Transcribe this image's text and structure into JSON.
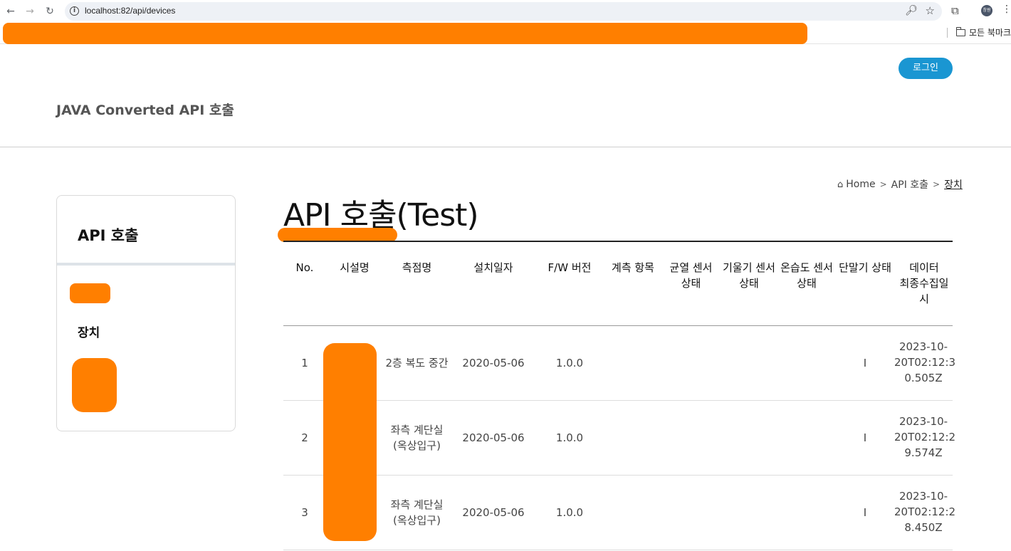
{
  "browser": {
    "url": "localhost:82/api/devices",
    "bookmarks_all": "모든 북마크",
    "profile_initials": "창원"
  },
  "header": {
    "login_label": "로그인",
    "site_title": "JAVA Converted API 호출"
  },
  "sidebar": {
    "title": "API 호출",
    "items": [
      {
        "label": "장치"
      }
    ]
  },
  "breadcrumb": {
    "home": "Home",
    "level1": "API 호출",
    "current": "장치"
  },
  "page_title": "API 호출(Test)",
  "table": {
    "headers": [
      [
        "No."
      ],
      [
        "시설명"
      ],
      [
        "측점명"
      ],
      [
        "설치일자"
      ],
      [
        "F/W 버전"
      ],
      [
        "계측 항목"
      ],
      [
        "균열 센서",
        "상태"
      ],
      [
        "기울기 센서",
        "상태"
      ],
      [
        "온습도 센서",
        "상태"
      ],
      [
        "단말기 상태"
      ],
      [
        "데이터",
        "최종수집일",
        "시"
      ]
    ],
    "rows": [
      {
        "no": "1",
        "facility": "",
        "point": [
          "2층 복도 중간"
        ],
        "install_date": "2020-05-06",
        "fw": "1.0.0",
        "items": "",
        "crack": "",
        "tilt": "",
        "thermo": "",
        "terminal": "I",
        "last_collected": [
          "2023-10-",
          "20T02:12:3",
          "0.505Z"
        ]
      },
      {
        "no": "2",
        "facility": "",
        "point": [
          "좌측 계단실",
          "(옥상입구)"
        ],
        "install_date": "2020-05-06",
        "fw": "1.0.0",
        "items": "",
        "crack": "",
        "tilt": "",
        "thermo": "",
        "terminal": "I",
        "last_collected": [
          "2023-10-",
          "20T02:12:2",
          "9.574Z"
        ]
      },
      {
        "no": "3",
        "facility": "",
        "point": [
          "좌측 계단실",
          "(옥상입구)"
        ],
        "install_date": "2020-05-06",
        "fw": "1.0.0",
        "items": "",
        "crack": "",
        "tilt": "",
        "thermo": "",
        "terminal": "I",
        "last_collected": [
          "2023-10-",
          "20T02:12:2",
          "8.450Z"
        ]
      }
    ]
  },
  "colors": {
    "accent": "#1a96d2",
    "redaction": "#ff7f00"
  }
}
